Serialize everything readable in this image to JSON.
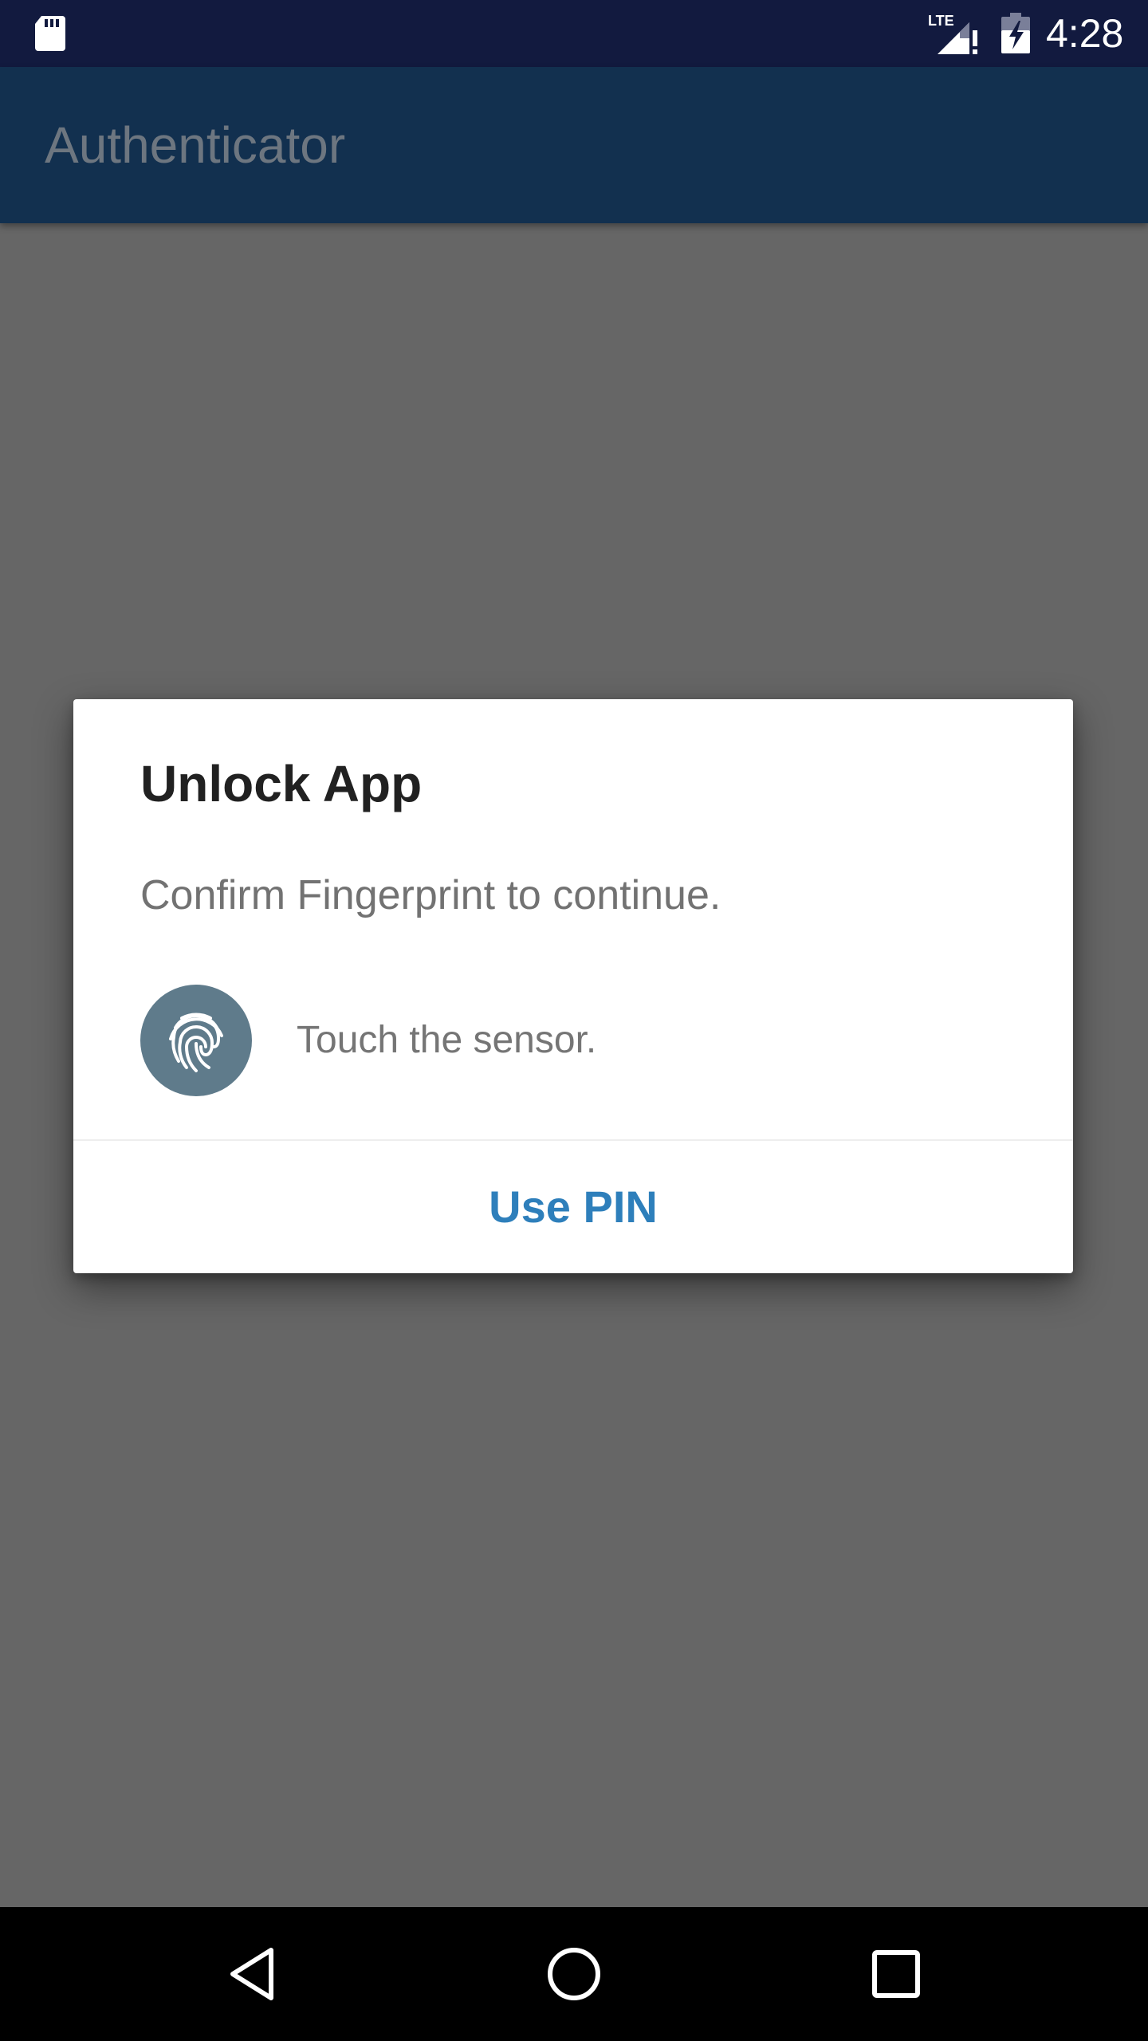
{
  "status_bar": {
    "time": "4:28",
    "icons": {
      "left": "sd-card-icon",
      "signal": "lte-signal-icon",
      "network_label": "LTE",
      "battery": "battery-charging-icon"
    }
  },
  "app_bar": {
    "title": "Authenticator"
  },
  "dialog": {
    "title": "Unlock App",
    "message": "Confirm Fingerprint to continue.",
    "fingerprint_icon": "fingerprint-icon",
    "sensor_hint": "Touch the sensor.",
    "button_label": "Use PIN",
    "button_color": "#2e7fbb",
    "icon_bg_color": "#5f7b8b"
  },
  "nav_bar": {
    "back": "back-icon",
    "home": "home-icon",
    "recents": "recents-icon"
  }
}
